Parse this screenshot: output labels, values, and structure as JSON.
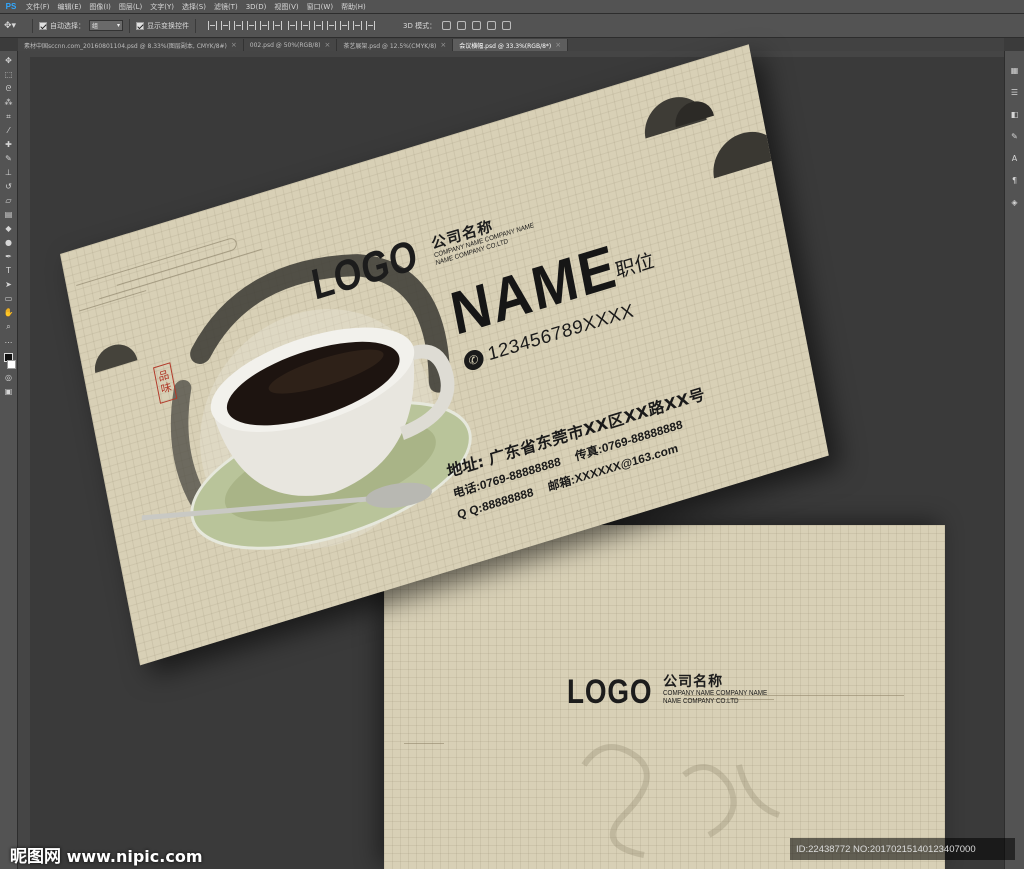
{
  "menubar": {
    "app_icon": "PS",
    "items": [
      "文件(F)",
      "编辑(E)",
      "图像(I)",
      "图层(L)",
      "文字(Y)",
      "选择(S)",
      "滤镜(T)",
      "3D(D)",
      "视图(V)",
      "窗口(W)",
      "帮助(H)"
    ]
  },
  "options": {
    "auto_select_label": "自动选择：",
    "auto_select_value": "组",
    "show_transform_label": "显示变换控件",
    "mode_3d_label": "3D 模式："
  },
  "tabs": [
    {
      "label": "素材中国sccnn.com_20160801104.psd @ 8.33%(图层副本, CMYK/8#)",
      "active": false
    },
    {
      "label": "002.psd @ 50%(RGB/8)",
      "active": false
    },
    {
      "label": "茶艺展架.psd @ 12.5%(CMYK/8)",
      "active": false
    },
    {
      "label": "会议横幅.psd @ 33.3%(RGB/8*)",
      "active": true
    }
  ],
  "card_front": {
    "logo": "LOGO",
    "company_cn": "公司名称",
    "company_en_1": "COMPANY NAME COMPANY NAME",
    "company_en_2": "NAME COMPANY CO.LTD",
    "seal": [
      "品",
      "味"
    ],
    "name": "NAME",
    "title": "职位",
    "phone": "123456789XXXX",
    "address_label": "地址:",
    "address": "广东省东莞市XX区XX路XX号",
    "tel": "电话:0769-88888888",
    "fax": "传真:0769-88888888",
    "qq": "Q Q:88888888",
    "email": "邮箱:XXXXXX@163.com"
  },
  "card_back": {
    "logo": "LOGO",
    "company_cn": "公司名称",
    "company_en_1": "COMPANY NAME COMPANY NAME",
    "company_en_2": "NAME COMPANY CO.LTD"
  },
  "watermark": {
    "site_logo": "昵图网",
    "site_url": "www.nipic.com",
    "image_id": "ID:22438772 NO:20170215140123407000"
  },
  "colors": {
    "paper": "#d8d0b6",
    "ink": "#1a1a1a",
    "seal_red": "#b23a2a",
    "ps_chrome": "#535353",
    "canvas": "#3a3a3a"
  }
}
